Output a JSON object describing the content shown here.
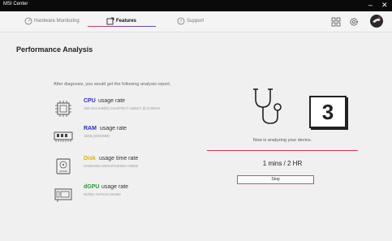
{
  "window": {
    "title": "MSI Center",
    "minimize": "–",
    "close": "✕"
  },
  "nav": {
    "tabs": [
      {
        "label": "Hardware Monitoring",
        "icon": "gauge-icon"
      },
      {
        "label": "Features",
        "icon": "features-icon",
        "active": true
      },
      {
        "label": "Support",
        "icon": "support-icon"
      }
    ],
    "icons": [
      "grid-icon",
      "gear-icon",
      "avatar"
    ],
    "accent_colors": [
      "#d23a5a",
      "#4a4ad0"
    ]
  },
  "page": {
    "title": "Performance Analysis"
  },
  "analysis": {
    "intro": "After diagnosis, you would get the following analysis report.",
    "metrics": [
      {
        "name": "CPU",
        "label": "usage rate",
        "detail": "11th Gen Intel(R) Core(TM) i7-1185G7 @ 3.00GHz",
        "color": "#2a2ad0",
        "icon": "cpu-icon"
      },
      {
        "name": "RAM",
        "label": "usage rate",
        "detail": "16GB (SODIMM)",
        "color": "#2a2ad0",
        "icon": "ram-icon"
      },
      {
        "name": "Disk",
        "label": "usage time rate",
        "detail": "SAMSUNG MZVL8T10HBLK-00000",
        "color": "#d8b400",
        "icon": "disk-icon"
      },
      {
        "name": "dGPU",
        "label": "usage rate",
        "detail": "NVIDIA GeForce MX450",
        "color": "#2a9a3a",
        "icon": "gpu-icon"
      }
    ]
  },
  "diagnosis": {
    "countdown": "3",
    "status": "Now is analyzing your device.",
    "progress": 1.0,
    "progress_color": "#d23a5a",
    "elapsed": "1 mins / 2 HR",
    "stop_label": "Stop"
  }
}
